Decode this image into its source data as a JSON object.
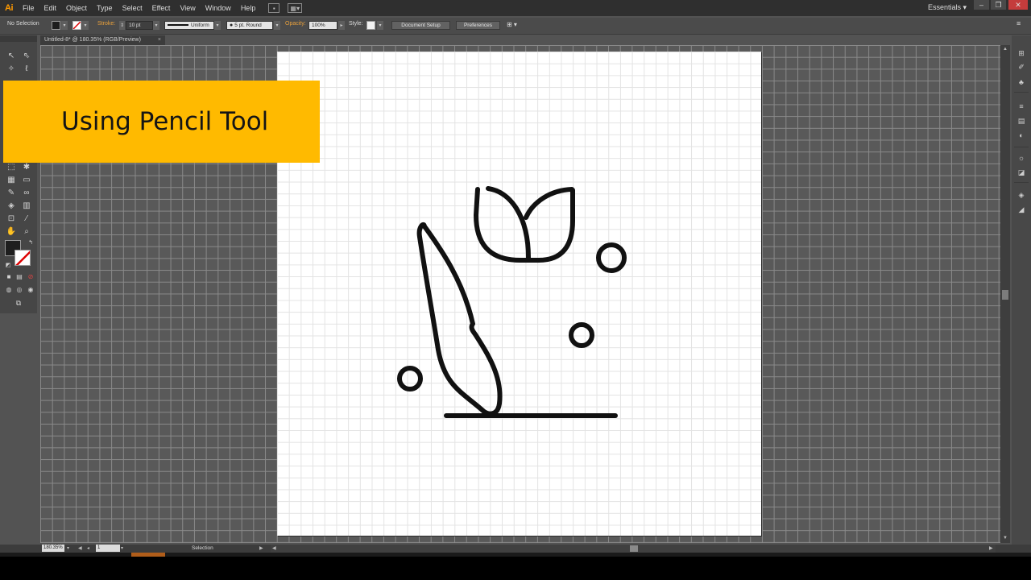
{
  "app": {
    "logo": "Ai"
  },
  "menu": [
    "File",
    "Edit",
    "Object",
    "Type",
    "Select",
    "Effect",
    "View",
    "Window",
    "Help"
  ],
  "workspace": {
    "label": "Essentials"
  },
  "control_bar": {
    "selection_label": "No Selection",
    "stroke_label": "Stroke:",
    "stroke_weight": "10 pt",
    "profile": "Uniform",
    "brush": "5 pt. Round",
    "opacity_label": "Opacity:",
    "opacity_value": "100%",
    "style_label": "Style:",
    "document_setup_btn": "Document Setup",
    "preferences_btn": "Preferences"
  },
  "document": {
    "tab_title": "Untitled-8* @ 180.35% (RGB/Preview)",
    "close": "×"
  },
  "status_bar": {
    "zoom": "180.35%",
    "page": "1",
    "tool_name": "Selection"
  },
  "overlay": {
    "title": "Using Pencil Tool"
  },
  "colors": {
    "banner": "#ffba00",
    "app_background": "#535353",
    "artboard": "#ffffff",
    "stroke": "#111111",
    "accent_orange": "#ff9a00"
  }
}
